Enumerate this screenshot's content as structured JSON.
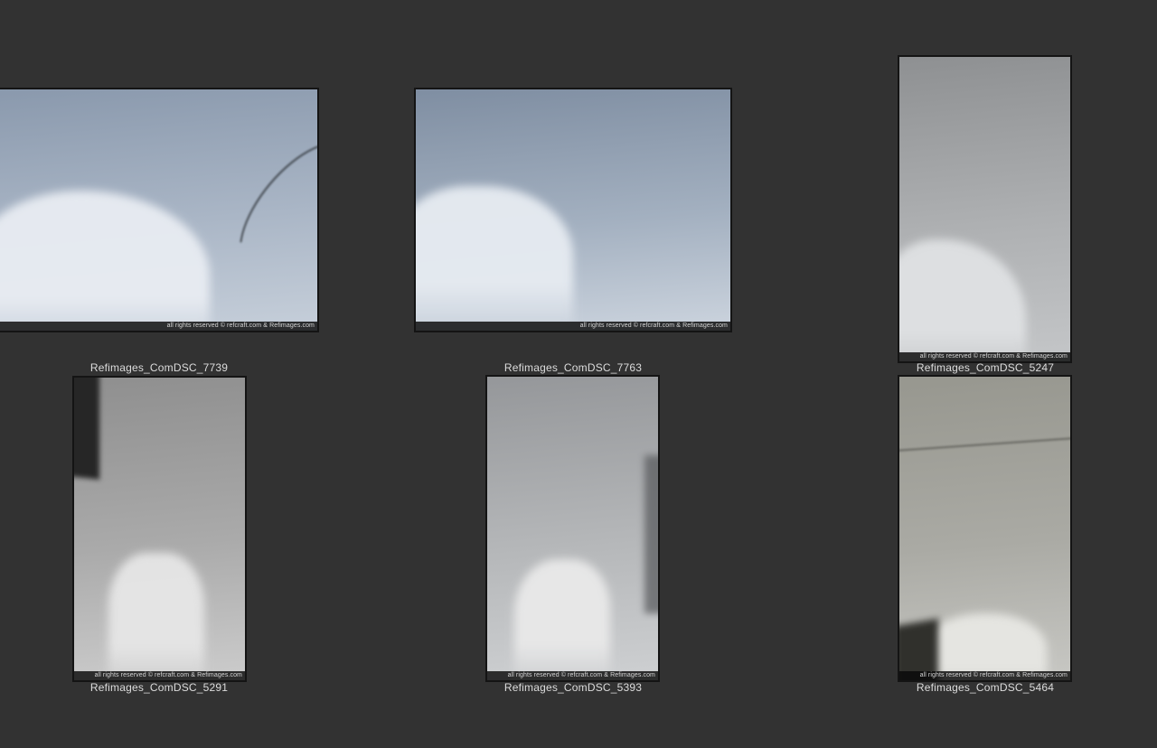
{
  "app": {
    "background": "#323232",
    "labelcolor": "#dcdcdc",
    "frame": "#141414"
  },
  "gallery": {
    "copyright": "all rights reserved © refcraft.com & Refimages.com",
    "items": [
      {
        "label": "Refimages_ComDSC_7739",
        "palette": {
          "backdrop": "#8a99ad",
          "backdrop2": "#aab6c6",
          "floor": "#c6cfda",
          "fabric": "#e8ecf2",
          "accent": "#2e3338"
        }
      },
      {
        "label": "Refimages_ComDSC_7763",
        "palette": {
          "backdrop": "#7f8ea2",
          "backdrop2": "#a3b0c0",
          "floor": "#ccd4de",
          "fabric": "#e6ebf1",
          "accent": "#5b6878"
        }
      },
      {
        "label": "Refimages_ComDSC_5247",
        "palette": {
          "backdrop": "#8e9092",
          "backdrop2": "#aeb0b2",
          "floor": "#c4c6c8",
          "fabric": "#dfe1e3",
          "accent": "#737577"
        }
      },
      {
        "label": "Refimages_ComDSC_5291",
        "palette": {
          "backdrop": "#8f8f8f",
          "backdrop2": "#aaaaaa",
          "floor": "#cccccc",
          "fabric": "#e6e6e6",
          "accent": "#262626"
        }
      },
      {
        "label": "Refimages_ComDSC_5393",
        "palette": {
          "backdrop": "#95979a",
          "backdrop2": "#b5b7b9",
          "floor": "#ced0d2",
          "fabric": "#e9e9e9",
          "accent": "#55575a"
        }
      },
      {
        "label": "Refimages_ComDSC_5464",
        "palette": {
          "backdrop": "#97978f",
          "backdrop2": "#aaaaa4",
          "floor": "#c8c8c4",
          "fabric": "#e7e7e3",
          "accent": "#30302c"
        }
      }
    ]
  }
}
